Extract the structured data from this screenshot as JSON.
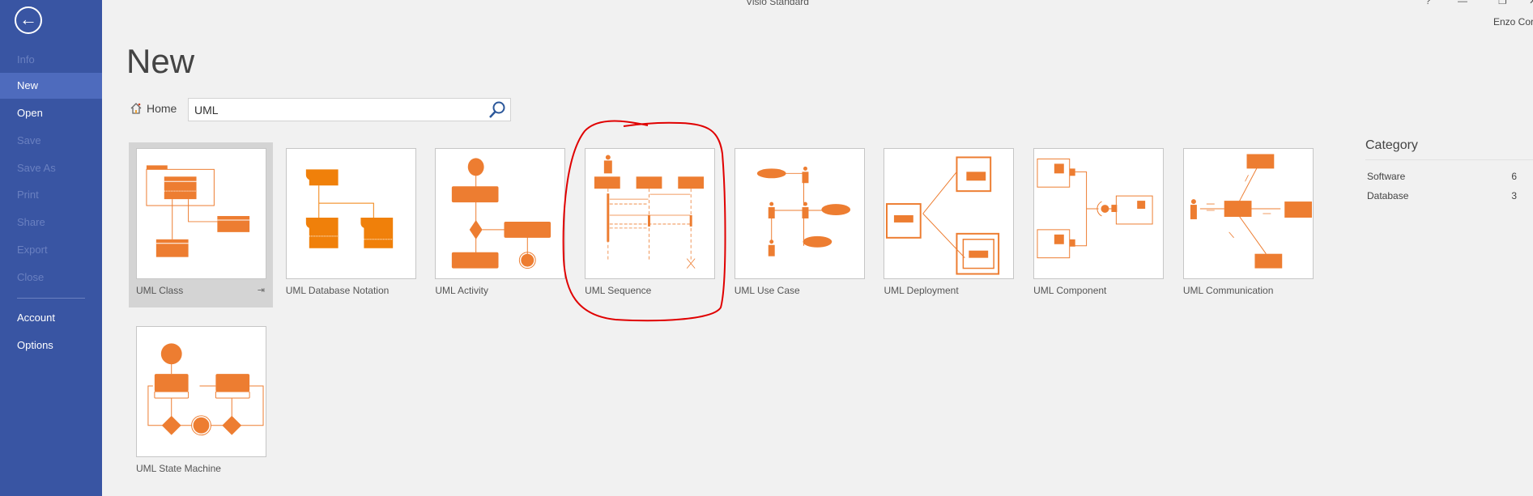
{
  "window": {
    "title": "Visio Standard",
    "user": "Enzo Cor",
    "controls": [
      "?",
      "minimize",
      "restore",
      "close"
    ]
  },
  "sidebar": {
    "back_icon": "back-arrow-icon",
    "items": [
      {
        "label": "Info",
        "enabled": false
      },
      {
        "label": "New",
        "enabled": true,
        "active": true
      },
      {
        "label": "Open",
        "enabled": true
      },
      {
        "label": "Save",
        "enabled": false
      },
      {
        "label": "Save As",
        "enabled": false
      },
      {
        "label": "Print",
        "enabled": false
      },
      {
        "label": "Share",
        "enabled": false
      },
      {
        "label": "Export",
        "enabled": false
      },
      {
        "label": "Close",
        "enabled": false
      },
      {
        "label": "Account",
        "enabled": true
      },
      {
        "label": "Options",
        "enabled": true
      }
    ]
  },
  "main": {
    "title": "New",
    "home_label": "Home",
    "search": {
      "value": "UML"
    },
    "templates": [
      {
        "label": "UML Class",
        "selected": true
      },
      {
        "label": "UML Database Notation"
      },
      {
        "label": "UML Activity"
      },
      {
        "label": "UML Sequence",
        "annotated": true
      },
      {
        "label": "UML Use Case"
      },
      {
        "label": "UML Deployment"
      },
      {
        "label": "UML Component"
      },
      {
        "label": "UML Communication"
      },
      {
        "label": "UML State Machine"
      }
    ],
    "pin_icon": "pin-icon"
  },
  "category": {
    "title": "Category",
    "items": [
      {
        "label": "Software",
        "count": "6"
      },
      {
        "label": "Database",
        "count": "3"
      }
    ]
  },
  "colors": {
    "sidebar": "#3955a3",
    "accent": "#ed7d31",
    "annotation": "#e00000"
  }
}
